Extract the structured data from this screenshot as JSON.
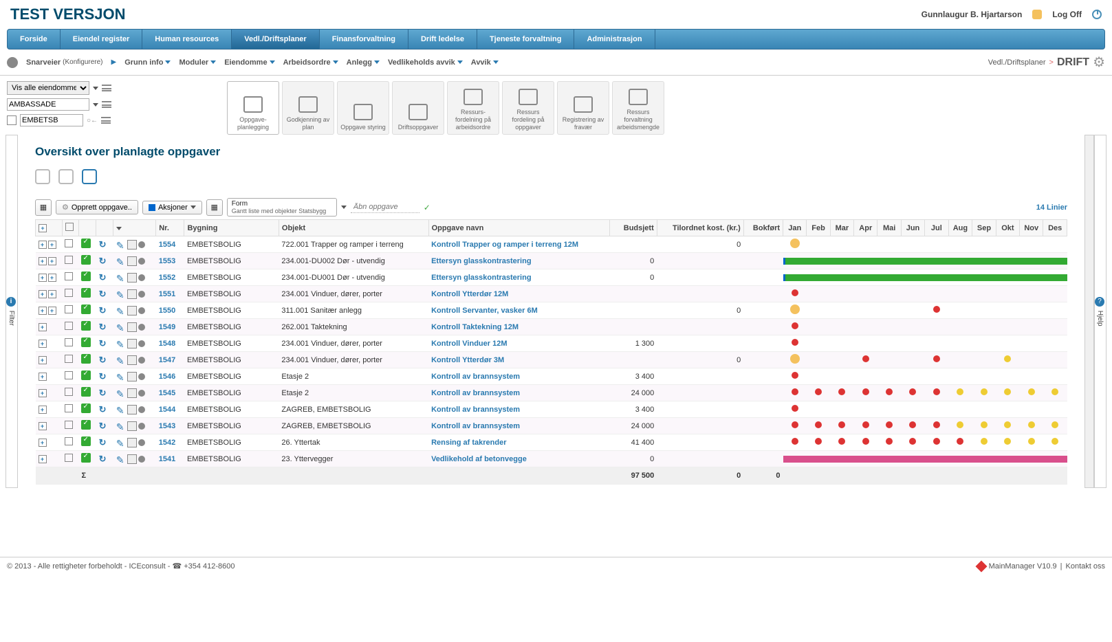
{
  "header": {
    "app_title": "TEST VERSJON",
    "user_name": "Gunnlaugur B. Hjartarson",
    "logoff": "Log Off"
  },
  "nav": {
    "tabs": [
      "Forside",
      "Eiendel register",
      "Human resources",
      "Vedl./Driftsplaner",
      "Finansforvaltning",
      "Drift ledelse",
      "Tjeneste forvaltning",
      "Administrasjon"
    ],
    "active": 3
  },
  "subnav": {
    "shortcuts": "Snarveier",
    "configure": "(Konfigurere)",
    "items": [
      "Grunn info",
      "Moduler",
      "Eiendomme",
      "Arbeidsordre",
      "Anlegg",
      "Vedlikeholds avvik",
      "Avvik"
    ],
    "breadcrumb_parent": "Vedl./Driftsplaner",
    "breadcrumb_current": "DRIFT"
  },
  "filters": {
    "property_select": "Vis alle eiendommer",
    "ambassade": "AMBASSADE",
    "embetsb": "EMBETSB"
  },
  "tool_cards": [
    {
      "label": "Oppgave-planlegging",
      "active": true
    },
    {
      "label": "Godkjenning av plan"
    },
    {
      "label": "Oppgave styring"
    },
    {
      "label": "Driftsoppgaver"
    },
    {
      "label": "Ressurs-fordelning på arbeidsordre"
    },
    {
      "label": "Ressurs fordeling på oppgaver"
    },
    {
      "label": "Registrering av fravær"
    },
    {
      "label": "Ressurs forvaltning arbeidsmengde"
    }
  ],
  "sidebar": {
    "filter": "Filter",
    "help": "Hjelp"
  },
  "content": {
    "title": "Oversikt over planlagte oppgaver",
    "create_btn": "Opprett oppgave..",
    "actions_btn": "Aksjoner",
    "form_label": "Form",
    "form_value": "Gantt liste med objekter Statsbygg",
    "search_placeholder": "Åbn oppgave",
    "line_count": "14 Linier"
  },
  "columns": {
    "nr": "Nr.",
    "bygning": "Bygning",
    "objekt": "Objekt",
    "oppgave": "Oppgave navn",
    "budsjett": "Budsjett",
    "tilordnet": "Tilordnet kost. (kr.)",
    "bokfort": "Bokført",
    "months": [
      "Jan",
      "Feb",
      "Mar",
      "Apr",
      "Mai",
      "Jun",
      "Jul",
      "Aug",
      "Sep",
      "Okt",
      "Nov",
      "Des"
    ]
  },
  "rows": [
    {
      "nr": "1554",
      "bygning": "EMBETSBOLIG",
      "objekt": "722.001 Trapper og ramper i terreng",
      "oppgave": "Kontroll Trapper og ramper i terreng 12M",
      "budsjett": "",
      "tilordnet": "0",
      "bokfort": "",
      "gantt": "face1"
    },
    {
      "nr": "1553",
      "bygning": "EMBETSBOLIG",
      "objekt": "234.001-DU002 Dør - utvendig",
      "oppgave": "Ettersyn glasskontrastering",
      "budsjett": "0",
      "tilordnet": "",
      "bokfort": "",
      "gantt": "greenbar"
    },
    {
      "nr": "1552",
      "bygning": "EMBETSBOLIG",
      "objekt": "234.001-DU001 Dør - utvendig",
      "oppgave": "Ettersyn glasskontrastering",
      "budsjett": "0",
      "tilordnet": "",
      "bokfort": "",
      "gantt": "greenbar"
    },
    {
      "nr": "1551",
      "bygning": "EMBETSBOLIG",
      "objekt": "234.001 Vinduer, dører, porter",
      "oppgave": "Kontroll Ytterdør 12M",
      "budsjett": "",
      "tilordnet": "",
      "bokfort": "",
      "gantt": "red1"
    },
    {
      "nr": "1550",
      "bygning": "EMBETSBOLIG",
      "objekt": "311.001 Sanitær anlegg",
      "oppgave": "Kontroll Servanter, vasker 6M",
      "budsjett": "",
      "tilordnet": "0",
      "bokfort": "",
      "gantt": "face_red7"
    },
    {
      "nr": "1549",
      "bygning": "EMBETSBOLIG",
      "objekt": "262.001 Taktekning",
      "oppgave": "Kontroll Taktekning 12M",
      "budsjett": "",
      "tilordnet": "",
      "bokfort": "",
      "gantt": "red1"
    },
    {
      "nr": "1548",
      "bygning": "EMBETSBOLIG",
      "objekt": "234.001 Vinduer, dører, porter",
      "oppgave": "Kontroll Vinduer 12M",
      "budsjett": "1 300",
      "tilordnet": "",
      "bokfort": "",
      "gantt": "red1"
    },
    {
      "nr": "1547",
      "bygning": "EMBETSBOLIG",
      "objekt": "234.001 Vinduer, dører, porter",
      "oppgave": "Kontroll Ytterdør 3M",
      "budsjett": "",
      "tilordnet": "0",
      "bokfort": "",
      "gantt": "face_3m"
    },
    {
      "nr": "1546",
      "bygning": "EMBETSBOLIG",
      "objekt": "Etasje 2",
      "oppgave": "Kontroll av brannsystem",
      "budsjett": "3 400",
      "tilordnet": "",
      "bokfort": "",
      "gantt": "red1"
    },
    {
      "nr": "1545",
      "bygning": "EMBETSBOLIG",
      "objekt": "Etasje 2",
      "oppgave": "Kontroll av brannsystem",
      "budsjett": "24 000",
      "tilordnet": "",
      "bokfort": "",
      "gantt": "monthly_ry"
    },
    {
      "nr": "1544",
      "bygning": "EMBETSBOLIG",
      "objekt": "ZAGREB, EMBETSBOLIG",
      "oppgave": "Kontroll av brannsystem",
      "budsjett": "3 400",
      "tilordnet": "",
      "bokfort": "",
      "gantt": "red1"
    },
    {
      "nr": "1543",
      "bygning": "EMBETSBOLIG",
      "objekt": "ZAGREB, EMBETSBOLIG",
      "oppgave": "Kontroll av brannsystem",
      "budsjett": "24 000",
      "tilordnet": "",
      "bokfort": "",
      "gantt": "monthly_ry"
    },
    {
      "nr": "1542",
      "bygning": "EMBETSBOLIG",
      "objekt": "26. Yttertak",
      "oppgave": "Rensing af takrender",
      "budsjett": "41 400",
      "tilordnet": "",
      "bokfort": "",
      "gantt": "monthly_ry2"
    },
    {
      "nr": "1541",
      "bygning": "EMBETSBOLIG",
      "objekt": "23. Yttervegger",
      "oppgave": "Vedlikehold af betonvegge",
      "budsjett": "0",
      "tilordnet": "",
      "bokfort": "",
      "gantt": "pinkbar"
    }
  ],
  "sum": {
    "sigma": "Σ",
    "budsjett": "97 500",
    "tilordnet": "0",
    "bokfort": "0"
  },
  "footer": {
    "copyright": "© 2013 - Alle rettigheter forbeholdt - ICEconsult - ☎ +354 412-8600",
    "version": "MainManager V10.9",
    "contact": "Kontakt oss"
  }
}
